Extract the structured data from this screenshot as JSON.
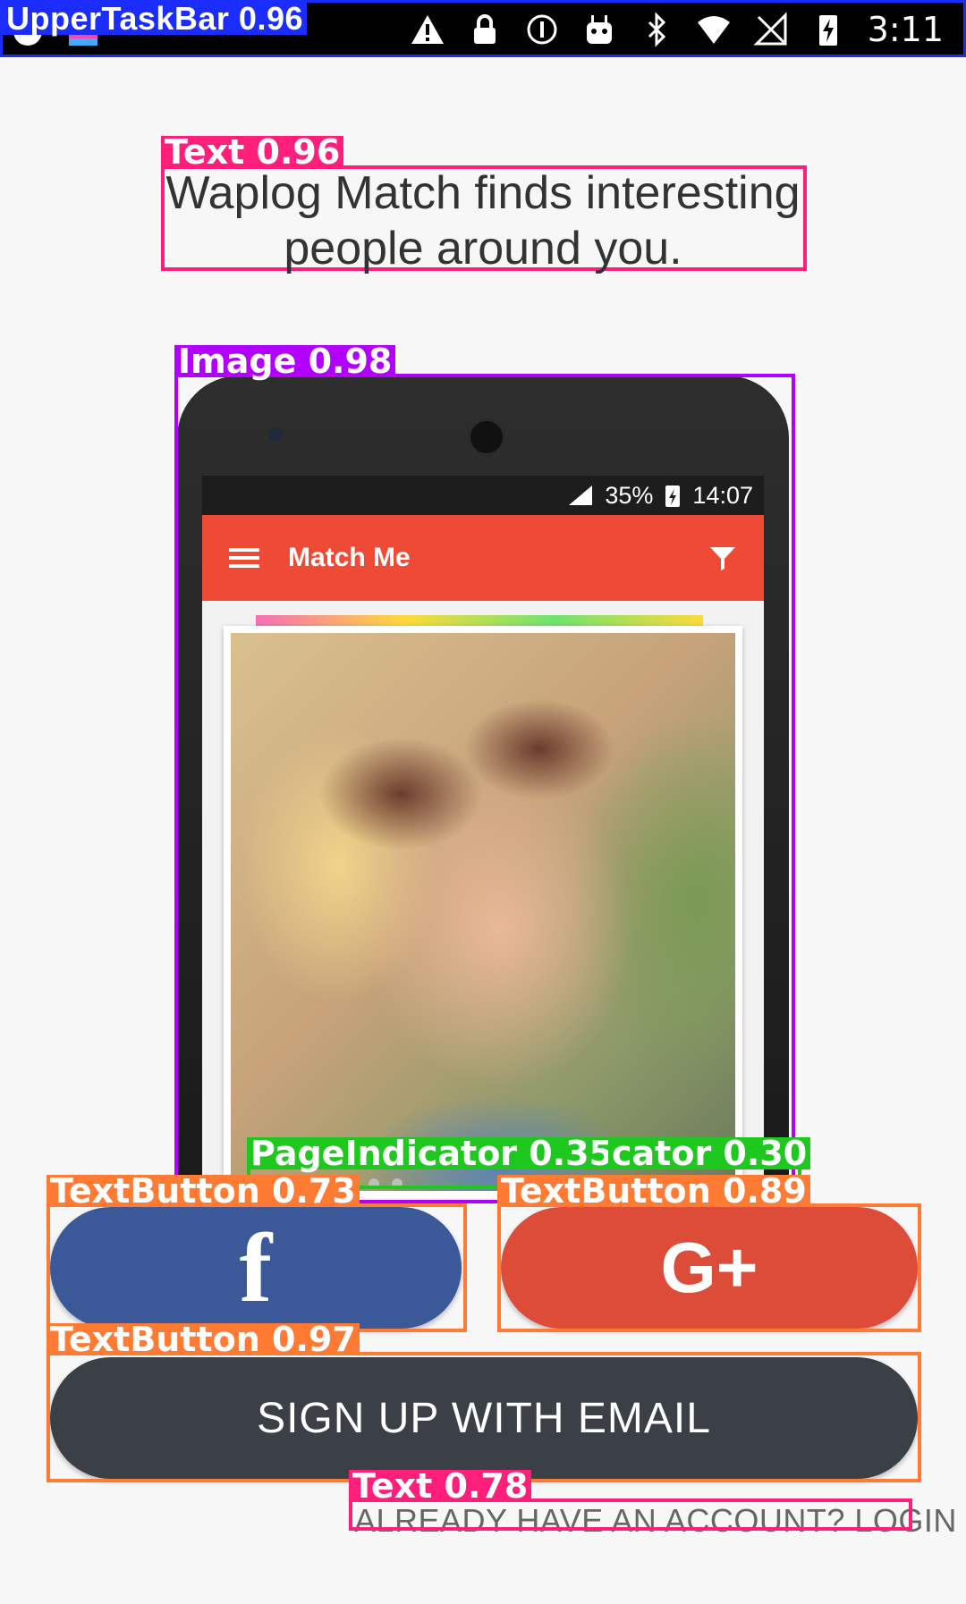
{
  "status_bar": {
    "time": "3:11",
    "icons": [
      "circle-app-icon",
      "colorful-app-icon",
      "warning-icon",
      "lock-icon",
      "info-icon",
      "android-icon",
      "bluetooth-icon",
      "wifi-icon",
      "no-signal-icon",
      "battery-charging-icon"
    ]
  },
  "headline": {
    "line1": "Waplog Match finds interesting",
    "line2": "people around you."
  },
  "phone_mock": {
    "inner_status_battery": "35%",
    "inner_status_time": "14:07",
    "app_title": "Match Me"
  },
  "buttons": {
    "facebook_glyph": "f",
    "google_glyph": "G+",
    "email_label": "SIGN UP WITH EMAIL"
  },
  "login_link": "ALREADY HAVE AN ACCOUNT? LOGIN",
  "detections": {
    "upper_taskbar": "UpperTaskBar 0.96",
    "text_headline": "Text 0.96",
    "image": "Image 0.98",
    "page_indicator": "PageIndicator 0.35",
    "page_indicator_2": "cator 0.30",
    "textbutton_fb": "TextButton 0.73",
    "textbutton_gp": "TextButton 0.89",
    "textbutton_email": "TextButton 0.97",
    "text_login": "Text 0.78"
  },
  "colors": {
    "facebook": "#3b5998",
    "google": "#dd4b39",
    "email_button": "#3b3f46",
    "app_bar": "#ef4a36"
  }
}
